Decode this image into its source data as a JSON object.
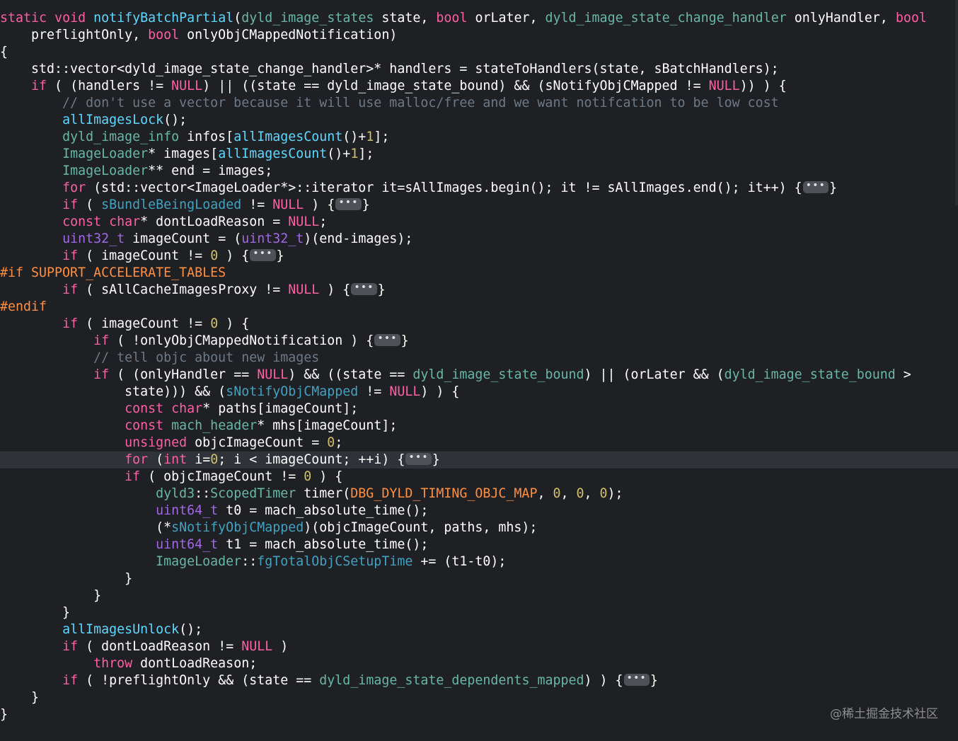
{
  "editor": {
    "current_line_index": 26,
    "lines": [
      [
        [
          "kw",
          "static"
        ],
        [
          "pl",
          " "
        ],
        [
          "kw",
          "void"
        ],
        [
          "pl",
          " "
        ],
        [
          "pf",
          "notifyBatchPartial"
        ],
        [
          "pl",
          "("
        ],
        [
          "pn",
          "dyld_image_states"
        ],
        [
          "pl",
          " state, "
        ],
        [
          "kw",
          "bool"
        ],
        [
          "pl",
          " orLater, "
        ],
        [
          "pn",
          "dyld_image_state_change_handler"
        ],
        [
          "pl",
          " onlyHandler, "
        ],
        [
          "kw",
          "bool"
        ]
      ],
      [
        [
          "pl",
          "    preflightOnly, "
        ],
        [
          "kw",
          "bool"
        ],
        [
          "pl",
          " onlyObjCMappedNotification)"
        ]
      ],
      [
        [
          "pl",
          "{"
        ]
      ],
      [
        [
          "pl",
          "    std::vector<dyld_image_state_change_handler>* handlers = stateToHandlers(state, sBatchHandlers);"
        ]
      ],
      [
        [
          "pl",
          "    "
        ],
        [
          "kw",
          "if"
        ],
        [
          "pl",
          " ( (handlers != "
        ],
        [
          "kw",
          "NULL"
        ],
        [
          "pl",
          ") || ((state == dyld_image_state_bound) && (sNotifyObjCMapped != "
        ],
        [
          "kw",
          "NULL"
        ],
        [
          "pl",
          ")) ) {"
        ]
      ],
      [
        [
          "cm",
          "        // don't use a vector because it will use malloc/free and we want notifcation to be low cost"
        ]
      ],
      [
        [
          "pl",
          "        "
        ],
        [
          "pf",
          "allImagesLock"
        ],
        [
          "pl",
          "();"
        ]
      ],
      [
        [
          "pl",
          "        "
        ],
        [
          "pn",
          "dyld_image_info"
        ],
        [
          "pl",
          " infos["
        ],
        [
          "pf",
          "allImagesCount"
        ],
        [
          "pl",
          "()+"
        ],
        [
          "nm",
          "1"
        ],
        [
          "pl",
          "];"
        ]
      ],
      [
        [
          "pl",
          "        "
        ],
        [
          "pn",
          "ImageLoader"
        ],
        [
          "pl",
          "* images["
        ],
        [
          "pf",
          "allImagesCount"
        ],
        [
          "pl",
          "()+"
        ],
        [
          "nm",
          "1"
        ],
        [
          "pl",
          "];"
        ]
      ],
      [
        [
          "pl",
          "        "
        ],
        [
          "pn",
          "ImageLoader"
        ],
        [
          "pl",
          "** end = images;"
        ]
      ],
      [
        [
          "pl",
          "        "
        ],
        [
          "kw",
          "for"
        ],
        [
          "pl",
          " (std::vector<ImageLoader*>::iterator it=sAllImages.begin(); it != sAllImages.end(); it++) {"
        ],
        [
          "fold",
          "•••"
        ],
        [
          "pl",
          "}"
        ]
      ],
      [
        [
          "pl",
          "        "
        ],
        [
          "kw",
          "if"
        ],
        [
          "pl",
          " ( "
        ],
        [
          "pv",
          "sBundleBeingLoaded"
        ],
        [
          "pl",
          " != "
        ],
        [
          "kw",
          "NULL"
        ],
        [
          "pl",
          " ) {"
        ],
        [
          "fold",
          "•••"
        ],
        [
          "pl",
          "}"
        ]
      ],
      [
        [
          "pl",
          "        "
        ],
        [
          "kw",
          "const"
        ],
        [
          "pl",
          " "
        ],
        [
          "kw",
          "char"
        ],
        [
          "pl",
          "* dontLoadReason = "
        ],
        [
          "kw",
          "NULL"
        ],
        [
          "pl",
          ";"
        ]
      ],
      [
        [
          "pl",
          "        "
        ],
        [
          "tp",
          "uint32_t"
        ],
        [
          "pl",
          " imageCount = ("
        ],
        [
          "tp",
          "uint32_t"
        ],
        [
          "pl",
          ")(end-images);"
        ]
      ],
      [
        [
          "pl",
          "        "
        ],
        [
          "kw",
          "if"
        ],
        [
          "pl",
          " ( imageCount != "
        ],
        [
          "nm",
          "0"
        ],
        [
          "pl",
          " ) {"
        ],
        [
          "fold",
          "•••"
        ],
        [
          "pl",
          "}"
        ]
      ],
      [
        [
          "pp",
          "#if SUPPORT_ACCELERATE_TABLES"
        ]
      ],
      [
        [
          "pl",
          "        "
        ],
        [
          "kw",
          "if"
        ],
        [
          "pl",
          " ( sAllCacheImagesProxy != "
        ],
        [
          "kw",
          "NULL"
        ],
        [
          "pl",
          " ) {"
        ],
        [
          "fold",
          "•••"
        ],
        [
          "pl",
          "}"
        ]
      ],
      [
        [
          "pp",
          "#endif"
        ]
      ],
      [
        [
          "pl",
          "        "
        ],
        [
          "kw",
          "if"
        ],
        [
          "pl",
          " ( imageCount != "
        ],
        [
          "nm",
          "0"
        ],
        [
          "pl",
          " ) {"
        ]
      ],
      [
        [
          "pl",
          "            "
        ],
        [
          "kw",
          "if"
        ],
        [
          "pl",
          " ( !onlyObjCMappedNotification ) {"
        ],
        [
          "fold",
          "•••"
        ],
        [
          "pl",
          "}"
        ]
      ],
      [
        [
          "cm",
          "            // tell objc about new images"
        ]
      ],
      [
        [
          "pl",
          "            "
        ],
        [
          "kw",
          "if"
        ],
        [
          "pl",
          " ( (onlyHandler == "
        ],
        [
          "kw",
          "NULL"
        ],
        [
          "pl",
          ") && ((state == "
        ],
        [
          "pn",
          "dyld_image_state_bound"
        ],
        [
          "pl",
          ") || (orLater && ("
        ],
        [
          "pn",
          "dyld_image_state_bound"
        ],
        [
          "pl",
          " >"
        ]
      ],
      [
        [
          "pl",
          "                state))) && ("
        ],
        [
          "pv",
          "sNotifyObjCMapped"
        ],
        [
          "pl",
          " != "
        ],
        [
          "kw",
          "NULL"
        ],
        [
          "pl",
          ") ) {"
        ]
      ],
      [
        [
          "pl",
          "                "
        ],
        [
          "kw",
          "const"
        ],
        [
          "pl",
          " "
        ],
        [
          "kw",
          "char"
        ],
        [
          "pl",
          "* paths[imageCount];"
        ]
      ],
      [
        [
          "pl",
          "                "
        ],
        [
          "kw",
          "const"
        ],
        [
          "pl",
          " "
        ],
        [
          "pn",
          "mach_header"
        ],
        [
          "pl",
          "* mhs[imageCount];"
        ]
      ],
      [
        [
          "pl",
          "                "
        ],
        [
          "kw",
          "unsigned"
        ],
        [
          "pl",
          " objcImageCount = "
        ],
        [
          "nm",
          "0"
        ],
        [
          "pl",
          ";"
        ]
      ],
      [
        [
          "pl",
          "                "
        ],
        [
          "kw",
          "for"
        ],
        [
          "pl",
          " ("
        ],
        [
          "kw",
          "int"
        ],
        [
          "pl",
          " i="
        ],
        [
          "nm",
          "0"
        ],
        [
          "pl",
          "; i < imageCount; ++i) {"
        ],
        [
          "fold",
          "•••"
        ],
        [
          "pl",
          "}"
        ]
      ],
      [
        [
          "pl",
          "                "
        ],
        [
          "kw",
          "if"
        ],
        [
          "pl",
          " ( objcImageCount != "
        ],
        [
          "nm",
          "0"
        ],
        [
          "pl",
          " ) {"
        ]
      ],
      [
        [
          "pl",
          "                    "
        ],
        [
          "pn",
          "dyld3"
        ],
        [
          "pl",
          "::"
        ],
        [
          "pn",
          "ScopedTimer"
        ],
        [
          "pl",
          " timer("
        ],
        [
          "pp",
          "DBG_DYLD_TIMING_OBJC_MAP"
        ],
        [
          "pl",
          ", "
        ],
        [
          "nm",
          "0"
        ],
        [
          "pl",
          ", "
        ],
        [
          "nm",
          "0"
        ],
        [
          "pl",
          ", "
        ],
        [
          "nm",
          "0"
        ],
        [
          "pl",
          ");"
        ]
      ],
      [
        [
          "pl",
          "                    "
        ],
        [
          "tp",
          "uint64_t"
        ],
        [
          "pl",
          " t0 = mach_absolute_time();"
        ]
      ],
      [
        [
          "pl",
          "                    (*"
        ],
        [
          "pv",
          "sNotifyObjCMapped"
        ],
        [
          "pl",
          ")(objcImageCount, paths, mhs);"
        ]
      ],
      [
        [
          "pl",
          "                    "
        ],
        [
          "tp",
          "uint64_t"
        ],
        [
          "pl",
          " t1 = mach_absolute_time();"
        ]
      ],
      [
        [
          "pl",
          "                    "
        ],
        [
          "pn",
          "ImageLoader"
        ],
        [
          "pl",
          "::"
        ],
        [
          "pv",
          "fgTotalObjCSetupTime"
        ],
        [
          "pl",
          " += (t1-t0);"
        ]
      ],
      [
        [
          "pl",
          "                }"
        ]
      ],
      [
        [
          "pl",
          "            }"
        ]
      ],
      [
        [
          "pl",
          "        }"
        ]
      ],
      [
        [
          "pl",
          "        "
        ],
        [
          "pf",
          "allImagesUnlock"
        ],
        [
          "pl",
          "();"
        ]
      ],
      [
        [
          "pl",
          "        "
        ],
        [
          "kw",
          "if"
        ],
        [
          "pl",
          " ( dontLoadReason != "
        ],
        [
          "kw",
          "NULL"
        ],
        [
          "pl",
          " )"
        ]
      ],
      [
        [
          "pl",
          "            "
        ],
        [
          "kw",
          "throw"
        ],
        [
          "pl",
          " dontLoadReason;"
        ]
      ],
      [
        [
          "pl",
          "        "
        ],
        [
          "kw",
          "if"
        ],
        [
          "pl",
          " ( !preflightOnly && (state == "
        ],
        [
          "pn",
          "dyld_image_state_dependents_mapped"
        ],
        [
          "pl",
          ") ) {"
        ],
        [
          "fold",
          "•••"
        ],
        [
          "pl",
          "}"
        ]
      ],
      [
        [
          "pl",
          "    }"
        ]
      ],
      [
        [
          "pl",
          "}"
        ]
      ]
    ]
  },
  "watermark": "@稀土掘金技术社区",
  "colors": {
    "background": "#1f2024",
    "current_line": "#2f3239",
    "keyword": "#fc5fa3",
    "number": "#d0bf69",
    "type": "#a167e6",
    "project_function": "#5dd8ff",
    "project_variable": "#41a1c0",
    "project_type": "#67b7a4",
    "comment": "#6c7986",
    "preprocessor": "#fd8f3f",
    "plain": "#ffffff",
    "fold_badge": "#4e5157"
  }
}
